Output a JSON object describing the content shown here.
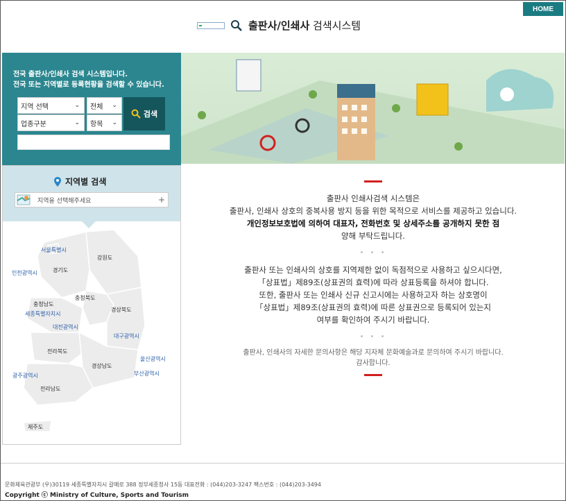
{
  "header": {
    "home_label": "HOME",
    "title_bold": "출판사/인쇄사",
    "title_rest": " 검색시스템"
  },
  "search": {
    "intro_line1": "전국 출판사/인쇄사 검색 시스템입니다.",
    "intro_line2": "전국 또는 지역별로 등록현황을 검색할 수 있습니다.",
    "region_select": "지역 선택",
    "all_select": "전체",
    "business_select": "업종구분",
    "item_select": "항목",
    "button_label": "검색",
    "keyword_value": ""
  },
  "region": {
    "title": "지역별 검색",
    "placeholder": "지역을 선택해주세요",
    "map_labels": {
      "seoul": "서울특별시",
      "gangwon": "강원도",
      "incheon": "인천광역시",
      "gyeonggi": "경기도",
      "chungbuk": "충청북도",
      "chungnam": "충청남도",
      "sejong": "세종특별자치시",
      "gyeongbuk": "경상북도",
      "daejeon": "대전광역시",
      "daegu": "대구광역시",
      "jeonbuk": "전라북도",
      "ulsan": "울산광역시",
      "gyeongnam": "경상남도",
      "gwangju": "광주광역시",
      "busan": "부산광역시",
      "jeonnam": "전라남도",
      "jeju": "제주도"
    }
  },
  "content": {
    "para1_line1": "출판사 인쇄사검색 시스템은",
    "para1_line2": "출판사, 인쇄사 상호의 중복사용 방지 등을 위한 목적으로 서비스를 제공하고 있습니다.",
    "para1_line3": "개인정보보호법에 의하여 대표자, 전화번호 및 상세주소를 공개하지 못한 점",
    "para1_line4": "양해 부탁드립니다.",
    "dots": "• • •",
    "para2_line1": "출판사 또는 인쇄사의 상호를 지역제한 없이 독점적으로 사용하고 싶으시다면,",
    "para2_line2": "「상표법」제89조(상표권의 효력)에 따라 상표등록을 하셔야 합니다.",
    "para2_line3": "또한, 출판사 또는 인쇄사 신규 신고시에는 사용하고자 하는 상호명이",
    "para2_line4": "「상표법」제89조(상표권의 효력)에 따른 상표권으로 등록되어 있는지",
    "para2_line5": "여부를 확인하여 주시기 바랍니다.",
    "para3_line1": "출판사, 인쇄사의 자세한 문의사항은 해당 지자체 문화예술과로 문의하여 주시기 바랍니다.",
    "para3_line2": "감사합니다."
  },
  "footer": {
    "address": "문화체육관광부 (우)30119 세종특별자치시 갈매로 388 정부세종청사 15동 대표전화 : (044)203-3247 팩스번호 : (044)203-3494",
    "copyright": "Copyright ⓒ Ministry of Culture, Sports and Tourism"
  },
  "colors": {
    "teal": "#2b868f",
    "dark_teal": "#15555c",
    "red_accent": "#d21f1f",
    "region_bg": "#cfe3ea"
  }
}
